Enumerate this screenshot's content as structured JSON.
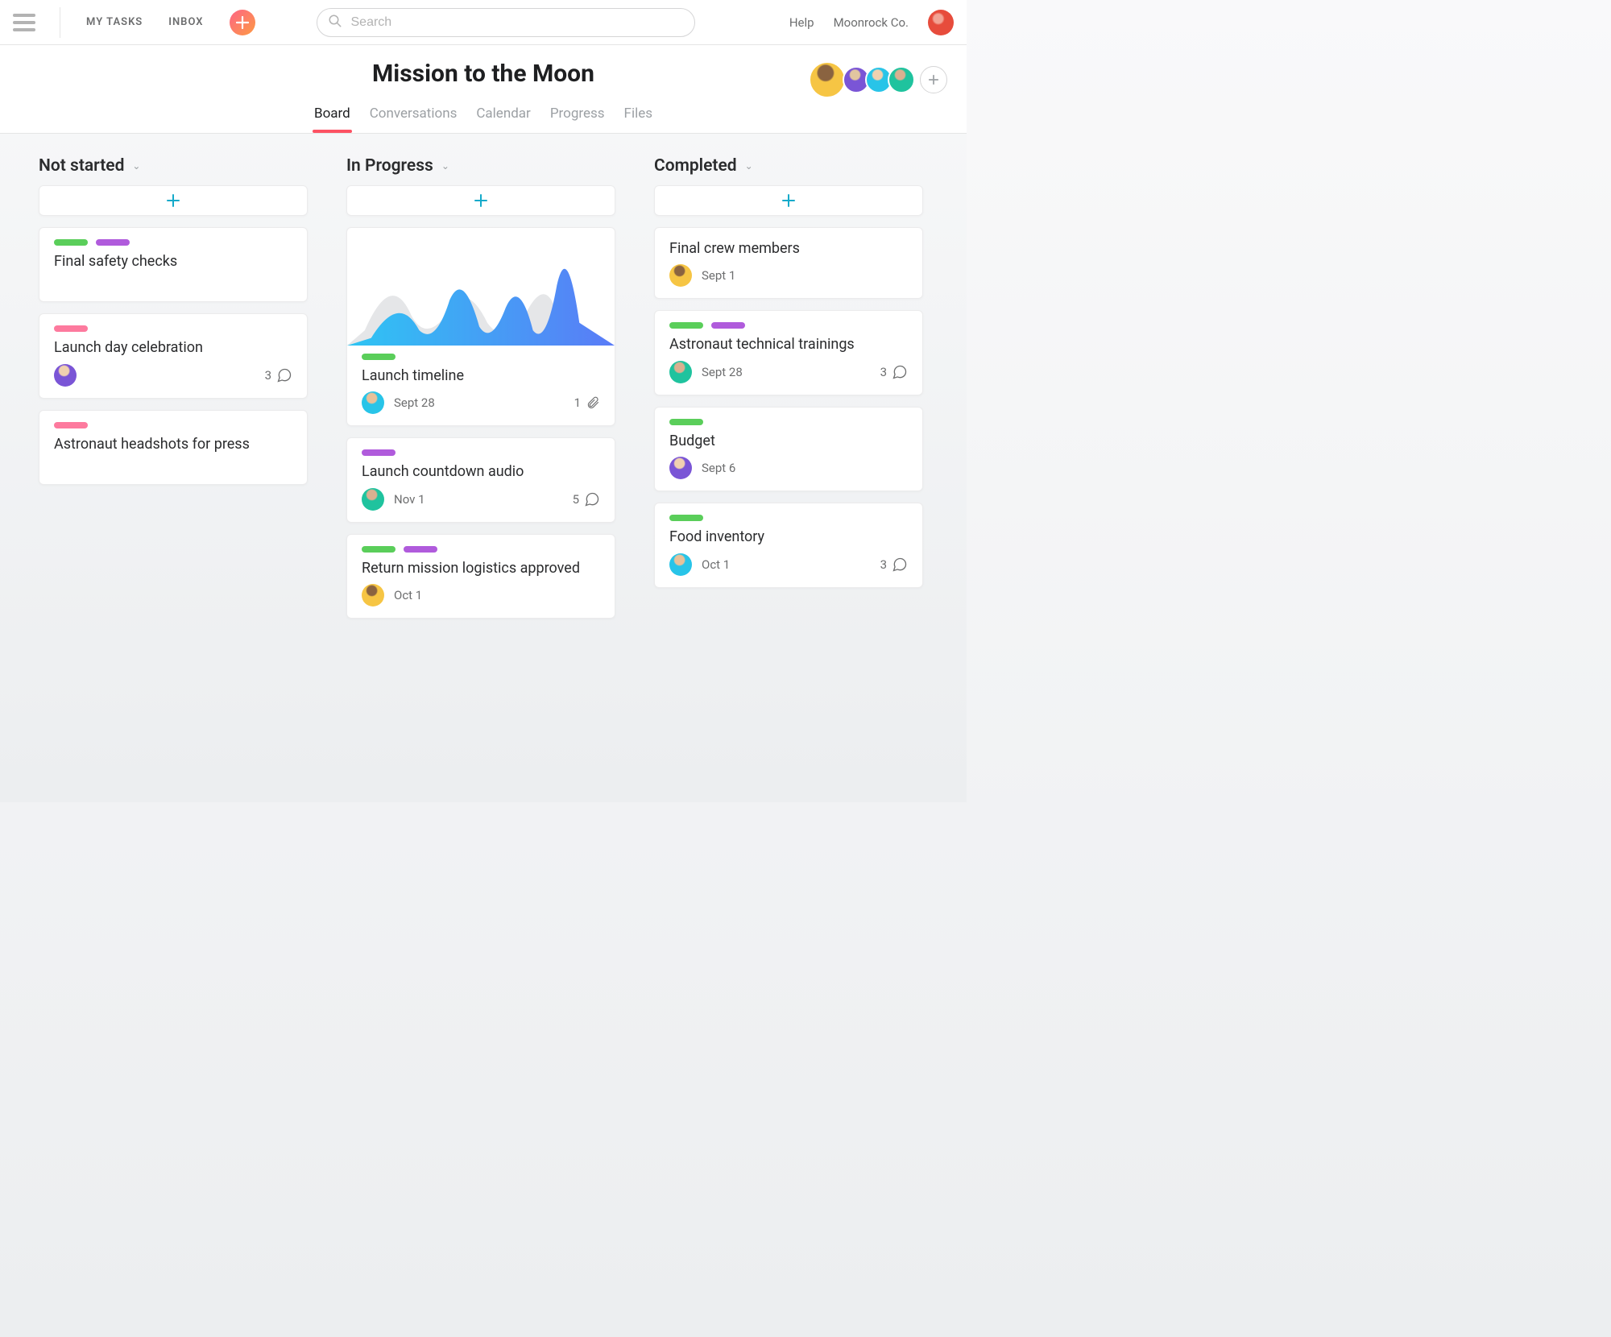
{
  "nav": {
    "my_tasks": "MY TASKS",
    "inbox": "INBOX",
    "help": "Help",
    "org": "Moonrock Co."
  },
  "search": {
    "placeholder": "Search"
  },
  "project": {
    "title": "Mission to the Moon",
    "tabs": [
      "Board",
      "Conversations",
      "Calendar",
      "Progress",
      "Files"
    ],
    "active_tab": 0,
    "members": [
      "yellow",
      "purple",
      "blue",
      "green"
    ]
  },
  "columns": [
    {
      "title": "Not started",
      "cards": [
        {
          "tags": [
            "green",
            "purple"
          ],
          "title": "Final safety checks"
        },
        {
          "tags": [
            "pink"
          ],
          "title": "Launch day celebration",
          "avatar": "a1",
          "comments": 3
        },
        {
          "tags": [
            "pink"
          ],
          "title": "Astronaut headshots for press"
        }
      ]
    },
    {
      "title": "In Progress",
      "cards": [
        {
          "tags": [
            "green"
          ],
          "title": "Launch timeline",
          "date": "Sept 28",
          "avatar": "a2",
          "attachments": 1,
          "has_chart": true
        },
        {
          "tags": [
            "purple"
          ],
          "title": "Launch countdown audio",
          "date": "Nov 1",
          "avatar": "a4",
          "comments": 5
        },
        {
          "tags": [
            "green",
            "purple"
          ],
          "title": "Return mission logistics approved",
          "date": "Oct 1",
          "avatar": "a3"
        }
      ]
    },
    {
      "title": "Completed",
      "cards": [
        {
          "title": "Final crew members",
          "date": "Sept 1",
          "avatar": "a3"
        },
        {
          "tags": [
            "green",
            "purple"
          ],
          "title": "Astronaut technical trainings",
          "date": "Sept 28",
          "avatar": "a4",
          "comments": 3
        },
        {
          "tags": [
            "green"
          ],
          "title": "Budget",
          "date": "Sept 6",
          "avatar": "a1"
        },
        {
          "tags": [
            "green"
          ],
          "title": "Food inventory",
          "date": "Oct 1",
          "avatar": "a2",
          "comments": 3
        }
      ]
    }
  ]
}
